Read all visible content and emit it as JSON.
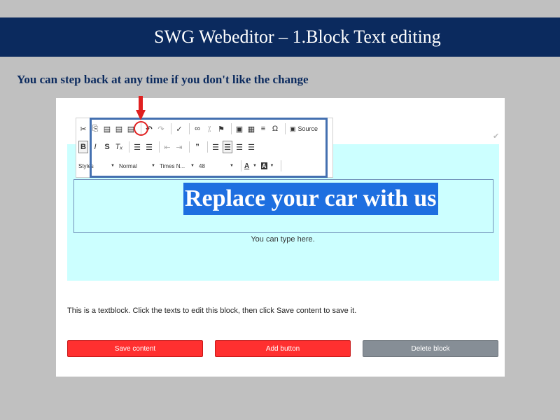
{
  "slide": {
    "title": "SWG Webeditor –  1.Block Text editing",
    "subtitle": "You can step back at any time if you don't like the change"
  },
  "colors": {
    "title_bar": "#0b2a5e",
    "editable_bg": "#ccffff",
    "selection": "#1e6fe0",
    "primary_button": "#ff3030",
    "secondary_button": "#868e96",
    "highlight": "#e02020"
  },
  "editor": {
    "headline": "Replace your car with us",
    "type_here": "You can type here.",
    "instruction": "This is a textblock. Click the texts to edit this block, then click Save content to save it.",
    "toolbar": {
      "row1": [
        {
          "icon": "cut-icon",
          "glyph": "✂"
        },
        {
          "icon": "copy-icon",
          "glyph": "⎘"
        },
        {
          "icon": "paste-icon",
          "glyph": "▤"
        },
        {
          "icon": "paste-text-icon",
          "glyph": "▤"
        },
        {
          "icon": "paste-word-icon",
          "glyph": "▤"
        },
        {
          "icon": "undo-icon",
          "glyph": "↶"
        },
        {
          "icon": "redo-icon",
          "glyph": "↷"
        },
        {
          "icon": "spellcheck-icon",
          "glyph": "✓"
        },
        {
          "icon": "link-icon",
          "glyph": "∞"
        },
        {
          "icon": "unlink-icon",
          "glyph": "⁒"
        },
        {
          "icon": "anchor-flag-icon",
          "glyph": "⚑"
        },
        {
          "icon": "image-icon",
          "glyph": "▣"
        },
        {
          "icon": "table-icon",
          "glyph": "▦"
        },
        {
          "icon": "horizontal-line-icon",
          "glyph": "≡"
        },
        {
          "icon": "special-char-icon",
          "glyph": "Ω"
        }
      ],
      "source_label": "Source",
      "row2": [
        {
          "icon": "bold-icon",
          "glyph": "B"
        },
        {
          "icon": "italic-icon",
          "glyph": "I"
        },
        {
          "icon": "strike-icon",
          "glyph": "S"
        },
        {
          "icon": "remove-format-icon",
          "glyph": "Tₓ"
        },
        {
          "icon": "numbered-list-icon",
          "glyph": "☰"
        },
        {
          "icon": "bulleted-list-icon",
          "glyph": "☰"
        },
        {
          "icon": "outdent-icon",
          "glyph": "⇤"
        },
        {
          "icon": "indent-icon",
          "glyph": "⇥"
        },
        {
          "icon": "blockquote-icon",
          "glyph": "”"
        },
        {
          "icon": "align-left-icon",
          "glyph": "☰"
        },
        {
          "icon": "align-center-icon",
          "glyph": "☰"
        },
        {
          "icon": "align-right-icon",
          "glyph": "☰"
        },
        {
          "icon": "justify-icon",
          "glyph": "☰"
        }
      ],
      "styles": "Styles",
      "format": "Normal",
      "font": "Times N...",
      "size": "48",
      "text_color_glyph": "A",
      "bg_color_glyph": "A"
    }
  },
  "buttons": {
    "save": "Save content",
    "add": "Add button",
    "delete": "Delete block"
  }
}
